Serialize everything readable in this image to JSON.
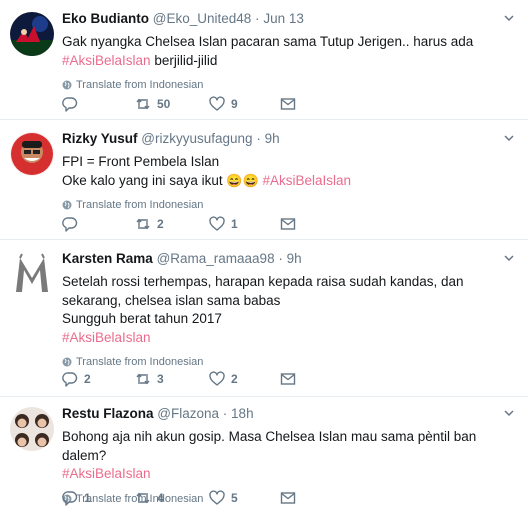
{
  "tweets": [
    {
      "name": "Eko Budianto",
      "handle": "@Eko_United48",
      "separator": "·",
      "time": "Jun 13",
      "lines": [
        "Gak nyangka Chelsea Islan pacaran sama Tutup Jerigen.. harus ada"
      ],
      "hashtag_line": {
        "hashtag": "#AksiBelaIslan",
        "text": " berjilid-jilid"
      },
      "translate": "Translate from Indonesian",
      "replies": "",
      "retweets": "50",
      "likes": "9"
    },
    {
      "name": "Rizky Yusuf",
      "handle": "@rizkyyusufagung",
      "separator": "·",
      "time": "9h",
      "lines": [
        "FPI = Front Pembela Islan"
      ],
      "emoji_line": {
        "text": "Oke kalo yang ini saya ikut ",
        "emoji": "😄😄",
        "hashtag": "#AksiBelaIslan"
      },
      "translate": "Translate from Indonesian",
      "replies": "",
      "retweets": "2",
      "likes": "1"
    },
    {
      "name": "Karsten Rama",
      "handle": "@Rama_ramaaa98",
      "separator": "·",
      "time": "9h",
      "lines": [
        "Setelah rossi terhempas, harapan kepada raisa sudah kandas, dan",
        "sekarang, chelsea islan sama babas",
        "Sungguh berat tahun 2017"
      ],
      "hashtag": "#AksiBelaIslan",
      "translate": "Translate from Indonesian",
      "replies": "2",
      "retweets": "3",
      "likes": "2"
    },
    {
      "name": "Restu Flazona",
      "handle": "@Flazona",
      "separator": "·",
      "time": "18h",
      "lines": [
        "Bohong aja nih akun gosip. Masa Chelsea Islan mau sama pèntil ban dalem?"
      ],
      "hashtag": "#AksiBelaIslan",
      "translate": "Translate from Indonesian",
      "replies": "1",
      "retweets": "4",
      "likes": "5"
    }
  ],
  "icons": {
    "reply": "reply-icon",
    "retweet": "retweet-icon",
    "like": "heart-icon",
    "dm": "envelope-icon",
    "globe": "globe-icon",
    "caret": "chevron-down-icon"
  },
  "colors": {
    "hashtag": "#ea6c8d",
    "muted": "#657786",
    "text": "#14171a",
    "divider": "#e6ecf0"
  }
}
